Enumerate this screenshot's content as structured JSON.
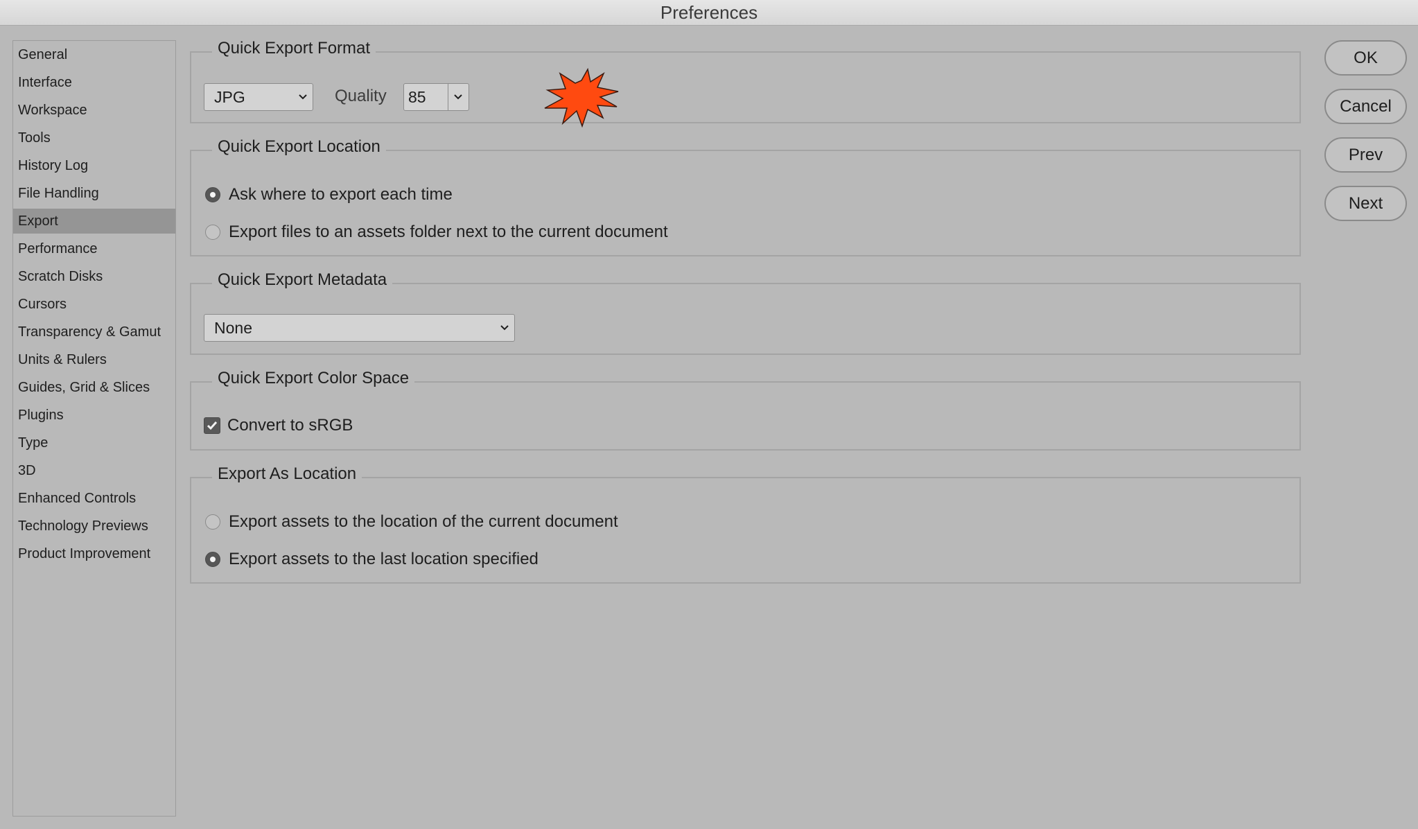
{
  "window": {
    "title": "Preferences"
  },
  "sidebar": {
    "selected": "Export",
    "items": [
      "General",
      "Interface",
      "Workspace",
      "Tools",
      "History Log",
      "File Handling",
      "Export",
      "Performance",
      "Scratch Disks",
      "Cursors",
      "Transparency & Gamut",
      "Units & Rulers",
      "Guides, Grid & Slices",
      "Plugins",
      "Type",
      "3D",
      "Enhanced Controls",
      "Technology Previews",
      "Product Improvement"
    ]
  },
  "quick_export_format": {
    "legend": "Quick Export Format",
    "format_value": "JPG",
    "quality_label": "Quality",
    "quality_value": "85"
  },
  "quick_export_location": {
    "legend": "Quick Export Location",
    "option_ask": "Ask where to export each time",
    "option_assets": "Export files to an assets folder next to the current document",
    "selected": "option_ask"
  },
  "quick_export_metadata": {
    "legend": "Quick Export Metadata",
    "value": "None"
  },
  "quick_export_color_space": {
    "legend": "Quick Export Color Space",
    "convert_label": "Convert to sRGB",
    "convert_checked": true
  },
  "export_as_location": {
    "legend": "Export As Location",
    "option_current": "Export assets to the location of the current document",
    "option_last": "Export assets to the last location specified",
    "selected": "option_last"
  },
  "buttons": {
    "ok": "OK",
    "cancel": "Cancel",
    "prev": "Prev",
    "next": "Next"
  },
  "colors": {
    "background": "#b9b9b9",
    "selected_item": "#959595",
    "burst": "#ff4a10"
  },
  "icons": [
    "chevron-down-icon",
    "check-icon",
    "starburst-marker-icon"
  ]
}
